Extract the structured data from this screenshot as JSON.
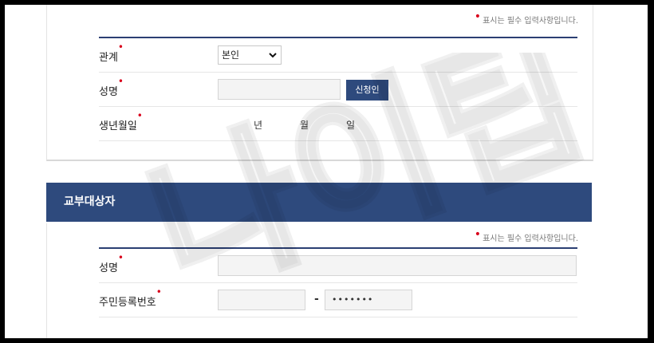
{
  "required_note": "표시는 필수 입력사항입니다.",
  "required_mark": "•",
  "applicant": {
    "relation_label": "관계",
    "relation_value": "본인",
    "name_label": "성명",
    "name_value": "",
    "verify_button": "신청인",
    "birth_label": "생년월일",
    "year_suffix": "년",
    "month_suffix": "월",
    "day_suffix": "일"
  },
  "recipient": {
    "section_title": "교부대상자",
    "name_label": "성명",
    "name_value": "",
    "rrn_label": "주민등록번호",
    "rrn_front": "",
    "rrn_separator": "-",
    "rrn_back": "•••••••"
  },
  "watermark_text": "나이팁",
  "colors": {
    "navy": "#2e4a7d",
    "required": "#d9001b"
  }
}
